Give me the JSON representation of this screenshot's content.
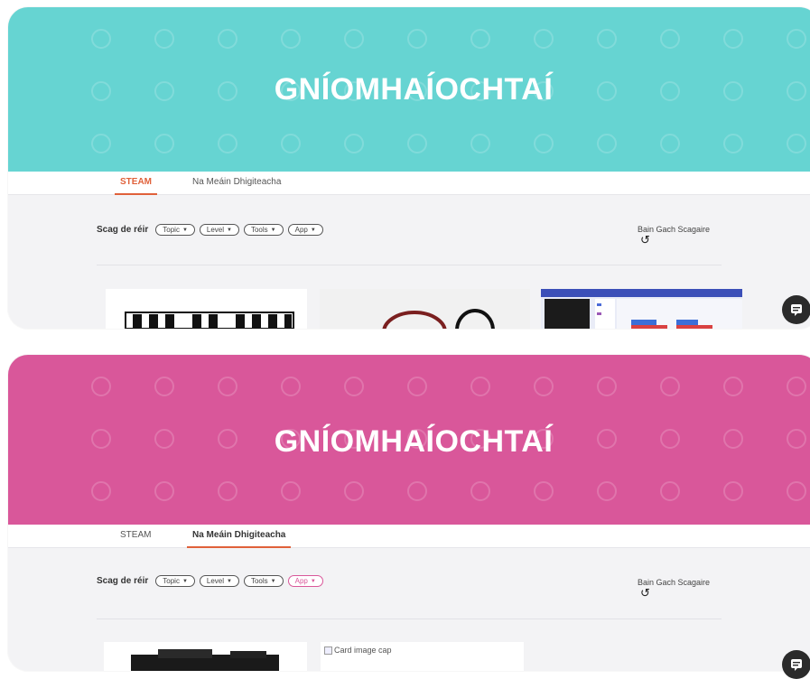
{
  "panels": [
    {
      "hero_title": "GNÍOMHAÍOCHTAÍ",
      "tabs": [
        {
          "label": "STEAM",
          "active": true
        },
        {
          "label": "Na Meáin Dhigiteacha",
          "active": false
        }
      ],
      "filter_label": "Scag de réir",
      "filters": [
        "Topic",
        "Level",
        "Tools",
        "App"
      ],
      "clear_label": "Bain Gach Scagaire",
      "accent": "#66d4d2"
    },
    {
      "hero_title": "GNÍOMHAÍOCHTAÍ",
      "tabs": [
        {
          "label": "STEAM",
          "active": false
        },
        {
          "label": "Na Meáin Dhigiteacha",
          "active": true
        }
      ],
      "filter_label": "Scag de réir",
      "filters": [
        "Topic",
        "Level",
        "Tools",
        "App"
      ],
      "clear_label": "Bain Gach Scagaire",
      "card_alt": "Card image cap",
      "accent": "#d9579a"
    }
  ],
  "icons": {
    "caret": "caret-down-icon",
    "undo": "undo-icon",
    "chat": "chat-icon"
  },
  "colors": {
    "teal": "#66d4d2",
    "pink": "#d9579a",
    "active_tab": "#e0613a"
  }
}
